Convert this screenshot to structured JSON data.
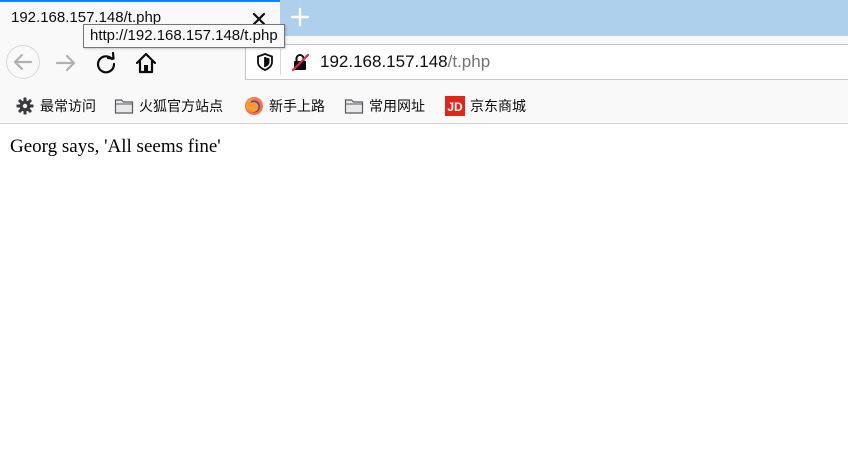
{
  "tab": {
    "title": "192.168.157.148/t.php"
  },
  "tooltip": {
    "text": "http://192.168.157.148/t.php"
  },
  "urlbar": {
    "host": "192.168.157.148",
    "path": "/t.php"
  },
  "bookmarks": [
    {
      "label": "最常访问",
      "icon": "gear-icon"
    },
    {
      "label": "火狐官方站点",
      "icon": "folder-icon"
    },
    {
      "label": "新手上路",
      "icon": "firefox-icon"
    },
    {
      "label": "常用网址",
      "icon": "folder-icon"
    },
    {
      "label": "京东商城",
      "icon": "jd-logo-icon",
      "icon_text": "JD"
    }
  ],
  "page": {
    "text": "Georg says, 'All seems fine'"
  },
  "colors": {
    "tabbar": "#afd0ec",
    "accent": "#0a84ff",
    "jd_red": "#e1251b"
  }
}
